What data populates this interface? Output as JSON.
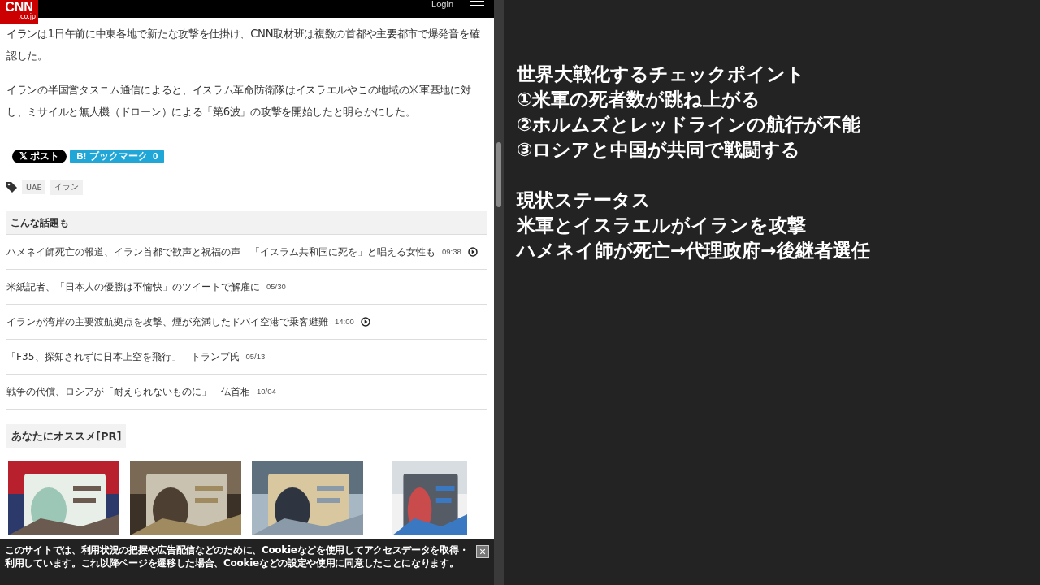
{
  "header": {
    "logo_top": "CNN",
    "logo_bottom": ".co.jp",
    "login": "Login"
  },
  "article": {
    "paragraphs": [
      "イランは1日午前に中東各地で新たな攻撃を仕掛け、CNN取材班は複数の首都や主要都市で爆発音を確認した。",
      "イランの半国営タスニム通信によると、イスラム革命防衛隊はイスラエルやこの地域の米軍基地に対し、ミサイルと無人機（ドローン）による「第6波」の攻撃を開始したと明らかにした。"
    ]
  },
  "share": {
    "post": "𝕏 ポスト",
    "bookmark": "B! ブックマーク",
    "bookmark_count": "0"
  },
  "tags": [
    "UAE",
    "イラン"
  ],
  "related": {
    "heading": "こんな話題も",
    "items": [
      {
        "title": "ハメネイ師死亡の報道、イラン首都で歓声と祝福の声　「イスラム共和国に死を」と唱える女性も",
        "time": "09:38",
        "video": true
      },
      {
        "title": "米紙記者、「日本人の優勝は不愉快」のツイートで解雇に",
        "time": "05/30",
        "video": false
      },
      {
        "title": "イランが湾岸の主要渡航拠点を攻撃、煙が充満したドバイ空港で乗客避難",
        "time": "14:00",
        "video": true
      },
      {
        "title": "「F35、探知されずに日本上空を飛行」　トランプ氏",
        "time": "05/13",
        "video": false
      },
      {
        "title": "戦争の代償、ロシアが「耐えられないものに」　仏首相",
        "time": "10/04",
        "video": false
      }
    ]
  },
  "recommend": {
    "heading": "あなたにオススメ[PR]"
  },
  "cookie_notice": {
    "text": "このサイトでは、利用状況の把握や広告配信などのために、Cookieなどを使用してアクセスデータを取得・利用しています。これ以降ページを遷移した場合、Cookieなどの設定や使用に同意したことになります。",
    "close": "×"
  },
  "overlay": {
    "blocks": [
      [
        "世界大戦化するチェックポイント",
        "①米軍の死者数が跳ね上がる",
        "②ホルムズとレッドラインの航行が不能",
        "③ロシアと中国が共同で戦闘する"
      ],
      [
        "現状ステータス",
        "米軍とイスラエルがイランを攻撃",
        "ハメネイ師が死亡→代理政府→後継者選任"
      ]
    ]
  }
}
